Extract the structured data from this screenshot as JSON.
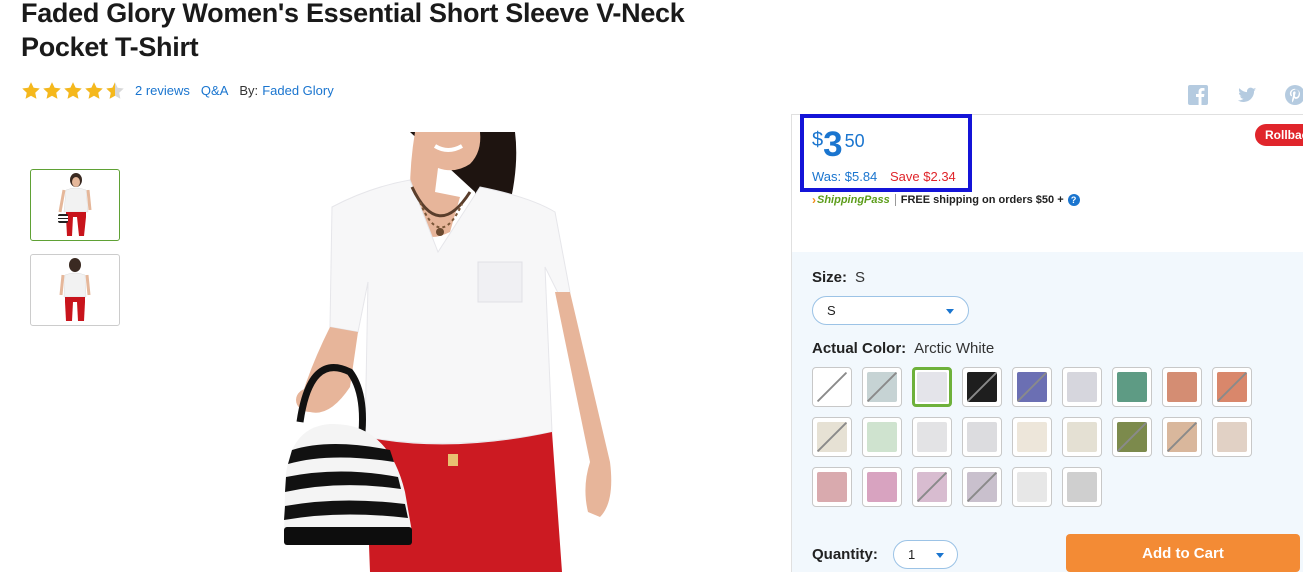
{
  "product": {
    "title": "Faded Glory Women's Essential Short Sleeve V-Neck Pocket T-Shirt",
    "rating": 4.5,
    "reviews_link": "2 reviews",
    "qa_link": "Q&A",
    "by_label": "By:",
    "brand_link": "Faded Glory"
  },
  "social": [
    "facebook-icon",
    "twitter-icon",
    "pinterest-icon"
  ],
  "price": {
    "currency": "$",
    "dollars": "3",
    "cents": "50",
    "was": "Was: $5.84",
    "save": "Save $2.34",
    "badge": "Rollback"
  },
  "shipping": {
    "program": "ShippingPass",
    "text": "FREE shipping on orders $50 +",
    "help": "?"
  },
  "size": {
    "label": "Size:",
    "value": "S",
    "selected": "S"
  },
  "color": {
    "label": "Actual Color:",
    "value": "Arctic White",
    "swatches": [
      {
        "color": "#ffffff",
        "unavailable": true,
        "selected": false
      },
      {
        "color": "#c6d3d4",
        "unavailable": true,
        "selected": false
      },
      {
        "color": "#e4e4ea",
        "unavailable": false,
        "selected": true
      },
      {
        "color": "#1e1e1e",
        "unavailable": true,
        "selected": false
      },
      {
        "color": "#6b6fb3",
        "unavailable": true,
        "selected": false
      },
      {
        "color": "#d6d6dd",
        "unavailable": false,
        "selected": false
      },
      {
        "color": "#5e9b84",
        "unavailable": false,
        "selected": false
      },
      {
        "color": "#d48d73",
        "unavailable": false,
        "selected": false
      },
      {
        "color": "#d9876b",
        "unavailable": true,
        "selected": false
      },
      {
        "color": "#e6e1d4",
        "unavailable": true,
        "selected": false
      },
      {
        "color": "#cfe3cf",
        "unavailable": false,
        "selected": false
      },
      {
        "color": "#e3e3e5",
        "unavailable": false,
        "selected": false
      },
      {
        "color": "#dcdcdf",
        "unavailable": false,
        "selected": false
      },
      {
        "color": "#ede6da",
        "unavailable": false,
        "selected": false
      },
      {
        "color": "#e4e0d3",
        "unavailable": false,
        "selected": false
      },
      {
        "color": "#7c8a4c",
        "unavailable": true,
        "selected": false
      },
      {
        "color": "#d9b79c",
        "unavailable": true,
        "selected": false
      },
      {
        "color": "#e1d1c5",
        "unavailable": false,
        "selected": false
      },
      {
        "color": "#d9aaae",
        "unavailable": false,
        "selected": false
      },
      {
        "color": "#d8a3c0",
        "unavailable": false,
        "selected": false
      },
      {
        "color": "#d8bcd0",
        "unavailable": true,
        "selected": false
      },
      {
        "color": "#c9c0cd",
        "unavailable": true,
        "selected": false
      },
      {
        "color": "#e7e7e7",
        "unavailable": false,
        "selected": false
      },
      {
        "color": "#cfcfcf",
        "unavailable": false,
        "selected": false
      }
    ]
  },
  "quantity": {
    "label": "Quantity:",
    "value": "1"
  },
  "add_to_cart": "Add to Cart",
  "colors": {
    "link": "#1a75cf",
    "price": "#1a75cf",
    "save": "#e0252b",
    "cta": "#f38b35",
    "star": "#f5b81c",
    "highlight": "#1414d8"
  }
}
